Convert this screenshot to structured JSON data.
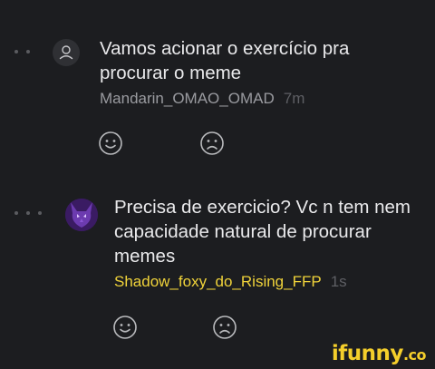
{
  "comments": [
    {
      "text": "Vamos acionar o exercício pra procurar o meme",
      "author": "Mandarin_OMAO_OMAD",
      "time": "7m",
      "avatar_icon": "default-user-icon"
    },
    {
      "text": "Precisa de exercicio? Vc n tem nem capacidade natural de procurar memes",
      "author": "Shadow_foxy_do_Rising_FFP",
      "time": "1s",
      "avatar_icon": "purple-creature-avatar"
    }
  ],
  "reaction_icons": [
    "smile-icon",
    "frown-icon"
  ],
  "watermark": {
    "main": "ifunny",
    "suffix": ".co"
  },
  "colors": {
    "background": "#1c1d20",
    "text": "#e9e9eb",
    "author_default": "#9a9ba0",
    "author_highlight": "#f0d33a",
    "muted": "#5e5f64",
    "brand": "#f5cf2b"
  }
}
